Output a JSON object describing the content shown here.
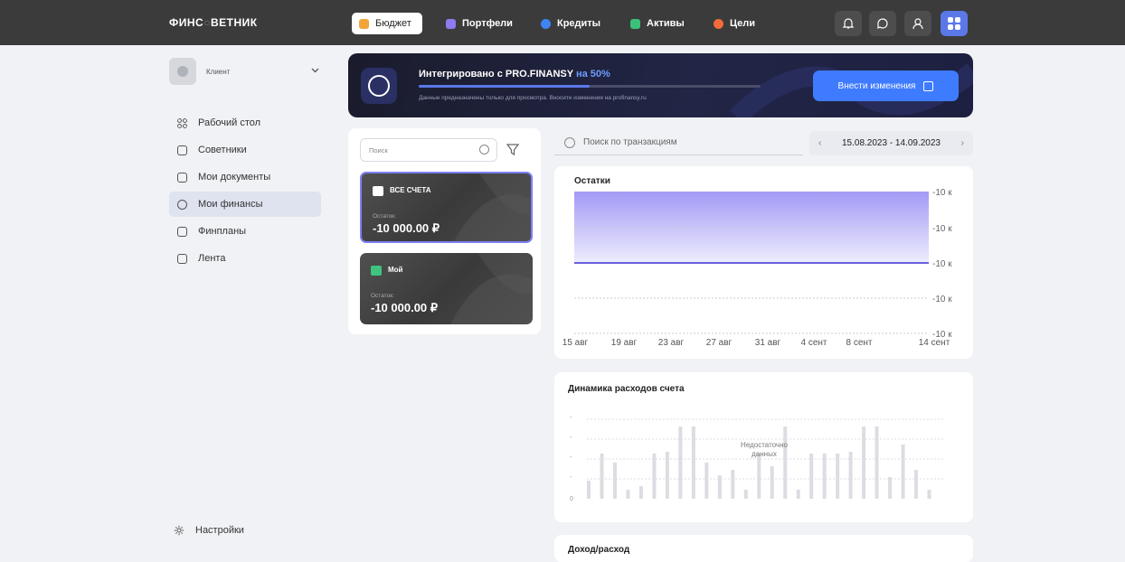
{
  "app": {
    "logo_a": "ФИНС",
    "logo_b": "ВЕТНИК"
  },
  "nav": {
    "tabs": [
      {
        "label": "Бюджет",
        "color": "#f2a33a"
      },
      {
        "label": "Портфели",
        "color": "#8c7cf0"
      },
      {
        "label": "Кредиты",
        "color": "#3f84f5"
      },
      {
        "label": "Активы",
        "color": "#39c07a"
      },
      {
        "label": "Цели",
        "color": "#f26b3a"
      }
    ],
    "icons": [
      "bell-icon",
      "chat-icon",
      "user-icon",
      "apps-icon"
    ]
  },
  "sidebar": {
    "user": "Клиент",
    "items": [
      {
        "label": "Рабочий стол",
        "icon": "grid-icon"
      },
      {
        "label": "Советники",
        "icon": "id-card-icon"
      },
      {
        "label": "Мои документы",
        "icon": "clipboard-icon"
      },
      {
        "label": "Мои финансы",
        "icon": "pie-icon"
      },
      {
        "label": "Финпланы",
        "icon": "chart-icon"
      },
      {
        "label": "Лента",
        "icon": "feed-icon"
      }
    ],
    "settings": "Настройки"
  },
  "banner": {
    "title": "Интегрировано с PRO.FINANSY",
    "title_accent": "на 50%",
    "progress": 0.5,
    "subtitle": "Данные предназначены только для просмотра. Вносите изменения на profinansy.ru",
    "button": "Внести изменения",
    "badge_text": "PRO FINANSY"
  },
  "accounts": {
    "search_placeholder": "Поиск",
    "cards": [
      {
        "name": "ВСЕ СЧЕТА",
        "balance_label": "Остаток:",
        "balance": "-10 000.00 ₽"
      },
      {
        "name": "Мой",
        "balance_label": "Остаток:",
        "balance": "-10 000.00 ₽"
      }
    ]
  },
  "transactions": {
    "search_placeholder": "Поиск по транзакциям",
    "date_range": "15.08.2023 - 14.09.2023"
  },
  "balance_chart": {
    "title": "Остатки"
  },
  "expense_chart": {
    "title": "Динамика расходов счета",
    "no_data": "Недостаточно данных"
  },
  "income_chart": {
    "title": "Доход/расход"
  },
  "chart_data": [
    {
      "type": "area",
      "title": "Остатки",
      "x": [
        "15 авг",
        "19 авг",
        "23 авг",
        "27 авг",
        "31 авг",
        "4 сент",
        "8 сент",
        "14 сент"
      ],
      "y_ticks": [
        "-10 к",
        "-10 к",
        "-10 к",
        "-10 к",
        "-10 к"
      ],
      "series": [
        {
          "values": [
            -10000,
            -10000,
            -10000,
            -10000,
            -10000,
            -10000,
            -10000,
            -10000
          ]
        }
      ]
    },
    {
      "type": "bar",
      "title": "Динамика расходов счета",
      "y_ticks": [
        "-",
        "-",
        "-",
        "-",
        "0"
      ],
      "values": [
        1,
        2.5,
        2,
        0.5,
        0.7,
        2.5,
        2.6,
        4,
        4,
        2,
        1.3,
        1.6,
        0.5,
        2.5,
        1.8,
        4,
        0.5,
        2.5,
        2.5,
        2.5,
        2.6,
        4,
        4,
        1.2,
        3,
        1.6,
        0.5
      ]
    }
  ]
}
